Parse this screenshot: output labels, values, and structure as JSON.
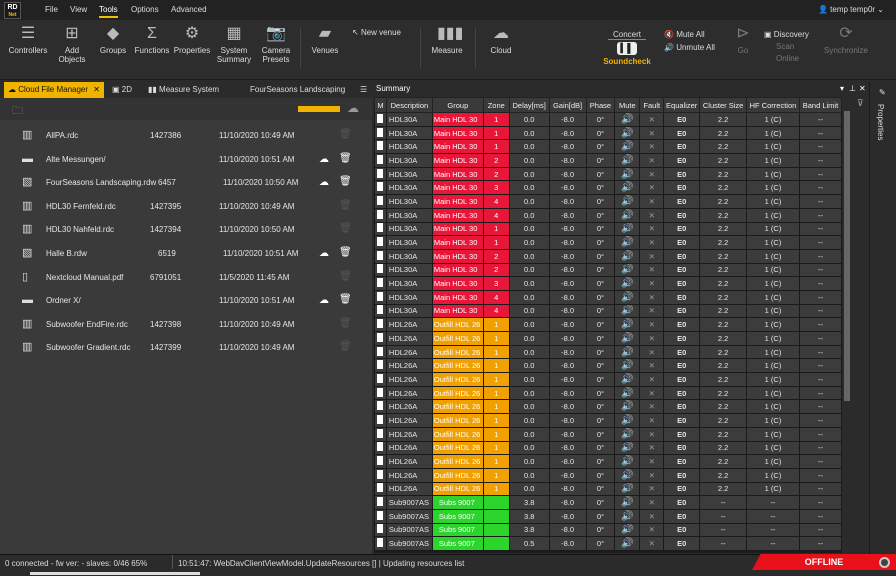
{
  "app": {
    "logo_top": "RD",
    "logo_bottom": "Net",
    "user": "temp temp0r"
  },
  "menu": [
    "File",
    "View",
    "Tools",
    "Options",
    "Advanced"
  ],
  "ribbon": {
    "controllers": "Controllers",
    "add_objects": "Add Objects",
    "groups": "Groups",
    "functions": "Functions",
    "properties": "Properties",
    "system_summary": "System Summary",
    "camera_presets": "Camera Presets",
    "venues": "Venues",
    "new_venue": "New venue",
    "measure": "Measure",
    "cloud": "Cloud",
    "concert": "Concert",
    "soundcheck": "Soundcheck",
    "mute_all": "Mute All",
    "unmute_all": "Unmute All",
    "go": "Go",
    "discovery": "Discovery",
    "scan": "Scan",
    "online": "Online",
    "synchronize": "Synchronize"
  },
  "left_tabs": {
    "cloud": "Cloud File Manager",
    "twod": "2D",
    "measure": "Measure System",
    "venue": "FourSeasons Landscaping"
  },
  "files": [
    {
      "name": "AllPA.rdc",
      "size": "1427386",
      "date": "11/10/2020 10:49 AM",
      "icon": "file-chart-icon",
      "actions": false
    },
    {
      "name": "Alte Messungen/",
      "size": "",
      "date": "11/10/2020 10:51 AM",
      "icon": "folder-icon",
      "actions": true
    },
    {
      "name": "FourSeasons Landscaping.rdw",
      "size": "6457",
      "date": "11/10/2020 10:50 AM",
      "icon": "file-wave-icon",
      "actions": true
    },
    {
      "name": "HDL30 Fernfeld.rdc",
      "size": "1427395",
      "date": "11/10/2020 10:49 AM",
      "icon": "file-chart-icon",
      "actions": false
    },
    {
      "name": "HDL30 Nahfeld.rdc",
      "size": "1427394",
      "date": "11/10/2020 10:50 AM",
      "icon": "file-chart-icon",
      "actions": false
    },
    {
      "name": "Halle B.rdw",
      "size": "6519",
      "date": "11/10/2020 10:51 AM",
      "icon": "file-wave-icon",
      "actions": true
    },
    {
      "name": "Nextcloud Manual.pdf",
      "size": "6791051",
      "date": "11/5/2020 11:45 AM",
      "icon": "file-icon",
      "actions": false
    },
    {
      "name": "Ordner X/",
      "size": "",
      "date": "11/10/2020 10:51 AM",
      "icon": "folder-icon",
      "actions": true
    },
    {
      "name": "Subwoofer EndFire.rdc",
      "size": "1427398",
      "date": "11/10/2020 10:49 AM",
      "icon": "file-chart-icon",
      "actions": false
    },
    {
      "name": "Subwoofer Gradient.rdc",
      "size": "1427399",
      "date": "11/10/2020 10:49 AM",
      "icon": "file-chart-icon",
      "actions": false
    }
  ],
  "summary": {
    "title": "Summary",
    "columns": [
      "M",
      "Description",
      "Group",
      "Zone",
      "Delay[ms]",
      "Gain[dB]",
      "Phase",
      "Mute",
      "Fault",
      "Equalizer",
      "Cluster Size",
      "HF Correction",
      "Band Limit"
    ],
    "rows": [
      [
        "HDL30A",
        "Main HDL 30",
        "1",
        "0.0",
        "-8.0",
        "0°",
        "red"
      ],
      [
        "HDL30A",
        "Main HDL 30",
        "1",
        "0.0",
        "-8.0",
        "0°",
        "red"
      ],
      [
        "HDL30A",
        "Main HDL 30",
        "1",
        "0.0",
        "-8.0",
        "0°",
        "red"
      ],
      [
        "HDL30A",
        "Main HDL 30",
        "2",
        "0.0",
        "-8.0",
        "0°",
        "red"
      ],
      [
        "HDL30A",
        "Main HDL 30",
        "2",
        "0.0",
        "-8.0",
        "0°",
        "red"
      ],
      [
        "HDL30A",
        "Main HDL 30",
        "3",
        "0.0",
        "-8.0",
        "0°",
        "red"
      ],
      [
        "HDL30A",
        "Main HDL 30",
        "4",
        "0.0",
        "-8.0",
        "0°",
        "red"
      ],
      [
        "HDL30A",
        "Main HDL 30",
        "4",
        "0.0",
        "-8.0",
        "0°",
        "red"
      ],
      [
        "HDL30A",
        "Main HDL 30",
        "1",
        "0.0",
        "-8.0",
        "0°",
        "red"
      ],
      [
        "HDL30A",
        "Main HDL 30",
        "1",
        "0.0",
        "-8.0",
        "0°",
        "red"
      ],
      [
        "HDL30A",
        "Main HDL 30",
        "2",
        "0.0",
        "-8.0",
        "0°",
        "red"
      ],
      [
        "HDL30A",
        "Main HDL 30",
        "2",
        "0.0",
        "-8.0",
        "0°",
        "red"
      ],
      [
        "HDL30A",
        "Main HDL 30",
        "3",
        "0.0",
        "-8.0",
        "0°",
        "red"
      ],
      [
        "HDL30A",
        "Main HDL 30",
        "4",
        "0.0",
        "-8.0",
        "0°",
        "red"
      ],
      [
        "HDL30A",
        "Main HDL 30",
        "4",
        "0.0",
        "-8.0",
        "0°",
        "red"
      ],
      [
        "HDL26A",
        "Outfill HDL 26",
        "1",
        "0.0",
        "-8.0",
        "0°",
        "or"
      ],
      [
        "HDL26A",
        "Outfill HDL 26",
        "1",
        "0.0",
        "-8.0",
        "0°",
        "or"
      ],
      [
        "HDL26A",
        "Outfill HDL 26",
        "1",
        "0.0",
        "-8.0",
        "0°",
        "or"
      ],
      [
        "HDL26A",
        "Outfill HDL 26",
        "1",
        "0.0",
        "-8.0",
        "0°",
        "or"
      ],
      [
        "HDL26A",
        "Outfill HDL 26",
        "1",
        "0.0",
        "-8.0",
        "0°",
        "or"
      ],
      [
        "HDL26A",
        "Outfill HDL 26",
        "1",
        "0.0",
        "-8.0",
        "0°",
        "or"
      ],
      [
        "HDL26A",
        "Outfill HDL 26",
        "1",
        "0.0",
        "-8.0",
        "0°",
        "or"
      ],
      [
        "HDL26A",
        "Outfill HDL 26",
        "1",
        "0.0",
        "-8.0",
        "0°",
        "or"
      ],
      [
        "HDL26A",
        "Outfill HDL 26",
        "1",
        "0.0",
        "-8.0",
        "0°",
        "or"
      ],
      [
        "HDL26A",
        "Outfill HDL 26",
        "1",
        "0.0",
        "-8.0",
        "0°",
        "or"
      ],
      [
        "HDL26A",
        "Outfill HDL 26",
        "1",
        "0.0",
        "-8.0",
        "0°",
        "or"
      ],
      [
        "HDL26A",
        "Outfill HDL 26",
        "1",
        "0.0",
        "-8.0",
        "0°",
        "or"
      ],
      [
        "HDL26A",
        "Outfill HDL 26",
        "1",
        "0.0",
        "-8.0",
        "0°",
        "or"
      ],
      [
        "Sub9007AS",
        "Subs 9007",
        "",
        "3.8",
        "-8.0",
        "0°",
        "gr"
      ],
      [
        "Sub9007AS",
        "Subs 9007",
        "",
        "3.8",
        "-8.0",
        "0°",
        "gr"
      ],
      [
        "Sub9007AS",
        "Subs 9007",
        "",
        "3.8",
        "-8.0",
        "0°",
        "gr"
      ],
      [
        "Sub9007AS",
        "Subs 9007",
        "",
        "0.5",
        "-8.0",
        "0°",
        "gr"
      ]
    ],
    "equalizer": "E0",
    "cluster_hdl": "2.2",
    "hf_hdl": "1 (C)",
    "band_hdl": "--",
    "cluster_sub": "--",
    "hf_sub": "--",
    "band_sub": "--"
  },
  "properties_label": "Properties",
  "status": {
    "left": "0 connected  - fw ver:  - slaves: 0/46  65%",
    "log": "10:51:47: WebDavClientViewModel.UpdateResources [] | Updating resources list",
    "offline": "OFFLINE"
  }
}
